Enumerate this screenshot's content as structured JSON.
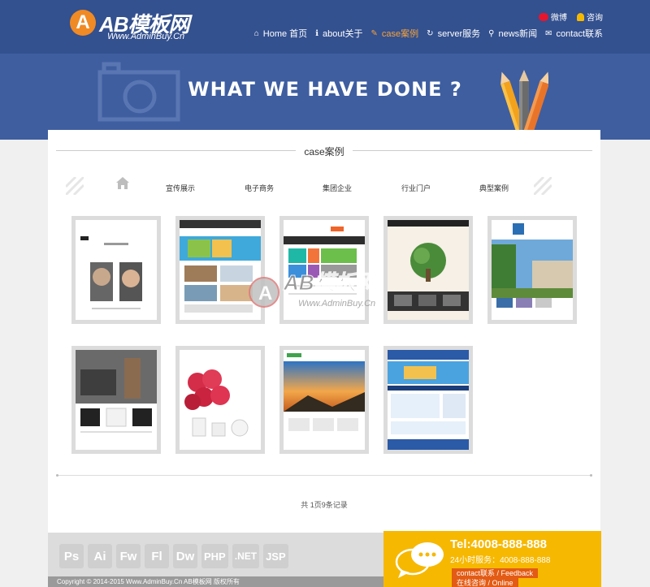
{
  "brand": {
    "logo_letter": "A",
    "title": "AB模板网",
    "subtitle": "Www.AdminBuy.Cn"
  },
  "top_links": [
    {
      "label": "微博",
      "icon": "weibo-icon",
      "color": "#e6162d"
    },
    {
      "label": "咨询",
      "icon": "qq-icon",
      "color": "#f5b800"
    }
  ],
  "nav": [
    {
      "label": "Home 首页",
      "icon": "home-icon",
      "glyph": "⌂",
      "active": false
    },
    {
      "label": "about关于",
      "icon": "info-icon",
      "glyph": "ℹ",
      "active": false
    },
    {
      "label": "case案例",
      "icon": "pencil-icon",
      "glyph": "✎",
      "active": true
    },
    {
      "label": "server服务",
      "icon": "refresh-icon",
      "glyph": "↻",
      "active": false
    },
    {
      "label": "news新闻",
      "icon": "search-icon",
      "glyph": "⚲",
      "active": false
    },
    {
      "label": "contact联系",
      "icon": "mail-icon",
      "glyph": "✉",
      "active": false
    }
  ],
  "banner": {
    "title": "WHAT WE HAVE DONE ?"
  },
  "section": {
    "title": "case案例"
  },
  "categories": [
    "宣传展示",
    "电子商务",
    "集团企业",
    "行业门户",
    "典型案例"
  ],
  "cases_row1": [
    "case-1",
    "case-2",
    "case-3",
    "case-4",
    "case-5"
  ],
  "cases_row2": [
    "case-6",
    "case-7",
    "case-8",
    "case-9"
  ],
  "pager": {
    "text": "共 1页9条记录"
  },
  "watermark": {
    "title": "AB模板网",
    "subtitle": "Www.AdminBuy.Cn"
  },
  "footer": {
    "badges": [
      "Ps",
      "Ai",
      "Fw",
      "Fl",
      "Dw",
      "PHP",
      ".NET",
      "JSP"
    ],
    "copyright": "Copyright © 2014-2015 Www.AdminBuy.Cn AB模板网 版权所有",
    "tel": "Tel:4008-888-888",
    "hotline": "24小时服务：4008-888-888",
    "feedback": "contact联系 / Feedback",
    "online": "在线咨询 / Online"
  },
  "colors": {
    "header": "#33508f",
    "banner": "#3e5ea0",
    "accent": "#f6a33a",
    "footer_contact": "#f6b800"
  }
}
